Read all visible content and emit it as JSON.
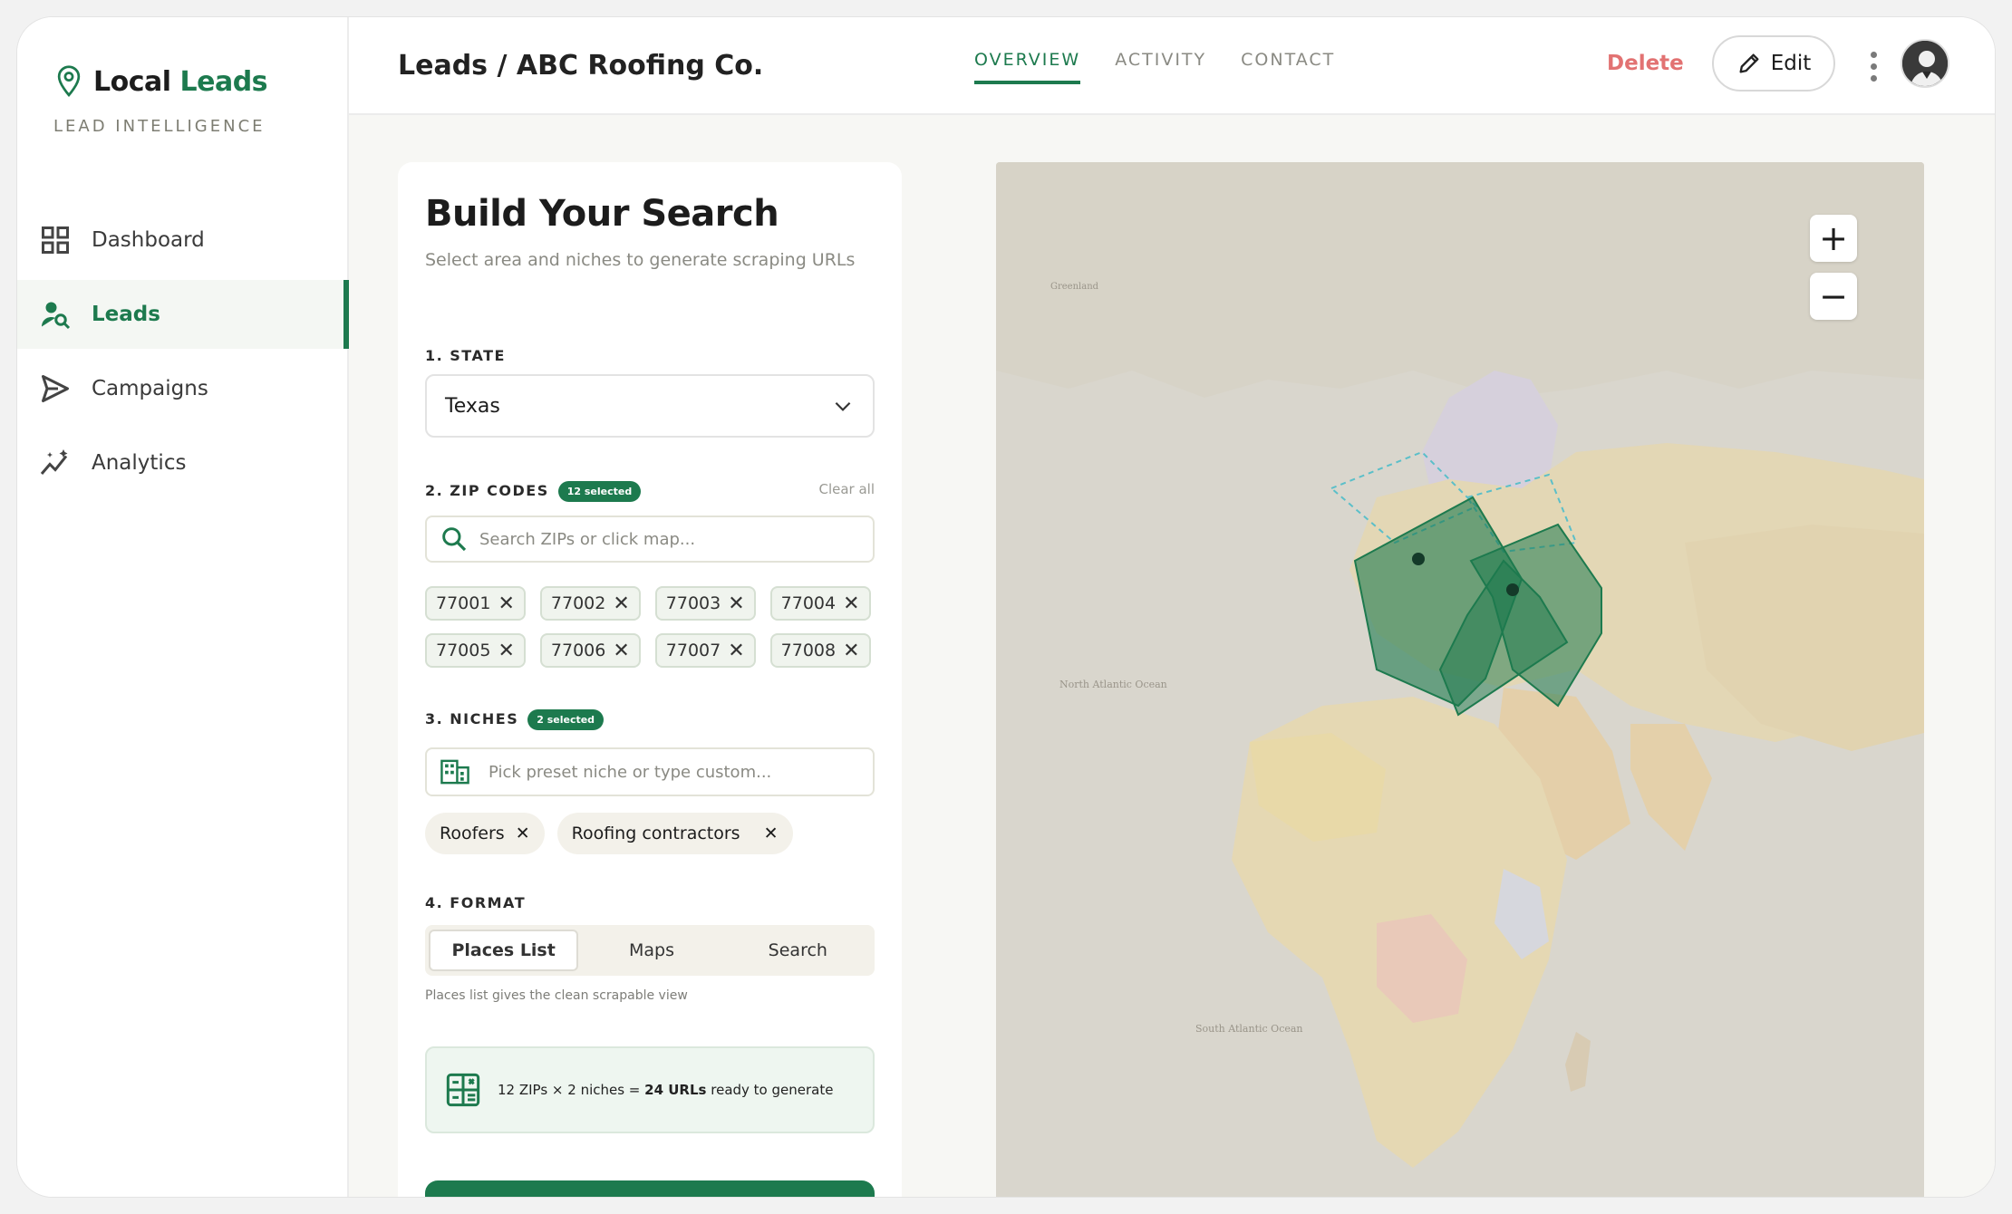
{
  "brand": {
    "name_primary": "Local",
    "name_accent": "Leads",
    "subtitle": "LEAD INTELLIGENCE"
  },
  "sidebar": {
    "items": [
      {
        "label": "Dashboard",
        "icon": "grid-icon",
        "active": false
      },
      {
        "label": "Leads",
        "icon": "user-search-icon",
        "active": true
      },
      {
        "label": "Campaigns",
        "icon": "send-icon",
        "active": false
      },
      {
        "label": "Analytics",
        "icon": "sparkline-icon",
        "active": false
      }
    ]
  },
  "header": {
    "breadcrumb": "Leads / ABC Roofing Co.",
    "tabs": [
      {
        "label": "OVERVIEW",
        "active": true
      },
      {
        "label": "ACTIVITY"
      },
      {
        "label": "CONTACT"
      }
    ],
    "delete_label": "Delete",
    "edit_label": "Edit"
  },
  "panel": {
    "title": "Build Your Search",
    "subtitle": "Select area and niches to generate scraping URLs",
    "state": {
      "label": "1. STATE",
      "value": "Texas"
    },
    "zips": {
      "label": "2. ZIP CODES",
      "badge": "12 selected",
      "clear": "Clear all",
      "placeholder": "Search ZIPs or click map...",
      "chips": [
        "77001",
        "77002",
        "77003",
        "77004",
        "77005",
        "77006",
        "77007",
        "77008"
      ]
    },
    "niches": {
      "label": "3. NICHES",
      "badge": "2 selected",
      "placeholder": "Pick preset niche or type custom...",
      "chips": [
        "Roofers",
        "Roofing contractors"
      ]
    },
    "format": {
      "label": "4. FORMAT",
      "options": [
        "Places List",
        "Maps",
        "Search"
      ],
      "selected": "Places List",
      "hint": "Places list gives the clean scrapable view"
    },
    "summary": {
      "prefix": "12 ZIPs × 2 niches = ",
      "strong": "24 URLs",
      "suffix": " ready to generate"
    }
  },
  "map": {
    "zoom_in": "+",
    "zoom_out": "−"
  },
  "colors": {
    "accent": "#1d7a4e",
    "danger": "#e27272"
  }
}
